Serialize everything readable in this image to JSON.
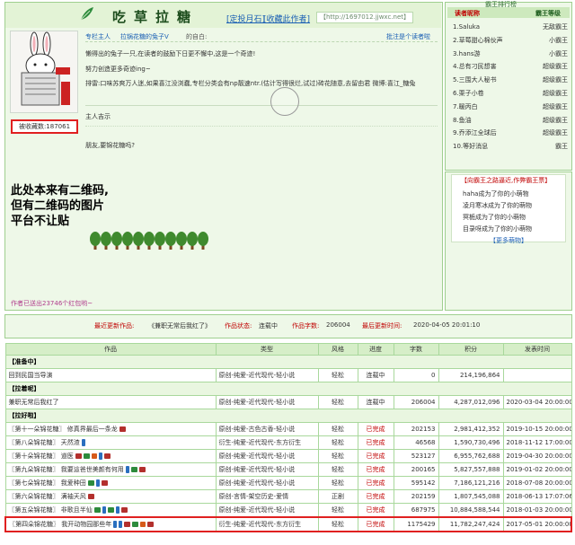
{
  "header": {
    "author_name": "吃草拉糖",
    "subscribe_link": "[定投月石]",
    "favorite_link": "[收藏此作者]",
    "url": "【http://1697012.jjwxc.net】"
  },
  "profile": {
    "role_label": "专栏主人",
    "title_label": "拉锅花糖的兔子V",
    "self_intro_label": "的自白:",
    "follow_link": "批注是个读者啦",
    "bio_line1": "懒得出的兔子一只,在读者的鼓励下日更不懈中,这是一个奇迹!",
    "bio_line2": "努力创造更多奇迹ing~",
    "bio_line3": "排雷:口味苏爽万人迷,如果喜江没浏蠢,专栏分类会有np靓速ntr.(估计写得很烂,试过)砖花随意,去留由君 微博:喜江_糖兔",
    "bio_line4": "主人吉示",
    "bio_line5": "朋友,要锦花糖吗?",
    "favorite_count": "被收藏数:187061",
    "qr_note_line1": "此处本来有二维码,",
    "qr_note_line2": "但有二维码的图片",
    "qr_note_line3": "平台不让贴",
    "sent_redbag": "作者已送出23746个红包哟~",
    "tree_count": 11
  },
  "fans": {
    "panel_title": "霸王排行榜",
    "col_reader": "读者昵称",
    "col_rank": "霸王等级",
    "rows": [
      {
        "name": "1.Saluka",
        "rank": "无敌霸王"
      },
      {
        "name": "2.草莓甜心棉伙声",
        "rank": "小霸王"
      },
      {
        "name": "3.hans游",
        "rank": "小霸王"
      },
      {
        "name": "4.总有刁民想害",
        "rank": "超级霸王"
      },
      {
        "name": "5.三围大人秘书",
        "rank": "超级霸王"
      },
      {
        "name": "6.栗子小卷",
        "rank": "超级霸王"
      },
      {
        "name": "7.暖丙白",
        "rank": "超级霸王"
      },
      {
        "name": "8.鱼油",
        "rank": "超级霸王"
      },
      {
        "name": "9.乔添江全球后",
        "rank": "超级霸王"
      },
      {
        "name": "10.等好消息",
        "rank": "霸王"
      }
    ],
    "box_title": "【向霸王之路逼近,作弊霸王票】",
    "news": [
      "haha成为了你的小萌物",
      "凌月寒冰成为了你的萌物",
      "冥栀成为了你的小萌物",
      "目录呀成为了你的小萌物"
    ],
    "more_pets": "【更多萌物】"
  },
  "latest_work": {
    "label": "最近更新作品:",
    "title": "《兼职无常后我红了》",
    "status_label": "作品状态:",
    "status": "连载中",
    "words_label": "作品字数:",
    "words": "206004",
    "time_label": "最后更新时间:",
    "time": "2020-04-05 20:01:10"
  },
  "works_table": {
    "headers": [
      "作品",
      "类型",
      "风格",
      "进度",
      "字数",
      "积分",
      "发表时间"
    ],
    "sections": [
      {
        "title": "【准备中】",
        "rows": [
          {
            "title": "回到民国当导演",
            "type": "原创-纯爱-近代现代-轻小说",
            "style": "轻松",
            "progress": "连载中",
            "words": "0",
            "score": "214,196,864",
            "date": "",
            "red": false,
            "tags": []
          }
        ]
      },
      {
        "title": "【拉着呢】",
        "rows": [
          {
            "title": "兼职无常后我红了",
            "type": "原创-纯爱-近代现代-轻小说",
            "style": "轻松",
            "progress": "连载中",
            "words": "206004",
            "score": "4,287,012,096",
            "date": "2020-03-04 20:00:00",
            "red": false,
            "tags": []
          }
        ]
      },
      {
        "title": "【拉好啦】",
        "rows": [
          {
            "title": "〖第十一朵锦花糖〗   修真界最后一条龙",
            "type": "原创-纯爱-古色古香-轻小说",
            "style": "轻松",
            "progress": "已完成",
            "words": "202153",
            "score": "2,981,412,352",
            "date": "2019-10-15 20:00:00",
            "red": true,
            "tags": [
              "book"
            ]
          },
          {
            "title": "〖第八朵锦花糖〗   天然渣",
            "type": "衍生-纯爱-近代现代-东方衍生",
            "style": "轻松",
            "progress": "已完成",
            "words": "46568",
            "score": "1,590,730,496",
            "date": "2018-11-12 17:00:00",
            "red": true,
            "tags": [
              "pen"
            ]
          },
          {
            "title": "〖第十朵锦花糖〗   道医",
            "type": "原创-纯爱-近代现代-轻小说",
            "style": "轻松",
            "progress": "已完成",
            "words": "523127",
            "score": "6,955,762,688",
            "date": "2019-04-30 20:00:00",
            "red": true,
            "tags": [
              "book",
              "green",
              "ladder",
              "pen",
              "book"
            ]
          },
          {
            "title": "〖第九朵锦花糖〗   我要這爸世美颜有何用",
            "type": "原创-纯爱-近代现代-轻小说",
            "style": "轻松",
            "progress": "已完成",
            "words": "200165",
            "score": "5,827,557,888",
            "date": "2019-01-02 20:00:00",
            "red": true,
            "tags": [
              "pen",
              "green",
              "book"
            ]
          },
          {
            "title": "〖第七朵锦花糖〗   我爱种田",
            "type": "原创-纯爱-近代现代-轻小说",
            "style": "轻松",
            "progress": "已完成",
            "words": "595142",
            "score": "7,186,121,216",
            "date": "2018-07-08 20:00:00",
            "red": true,
            "tags": [
              "green",
              "pen",
              "book"
            ]
          },
          {
            "title": "〖第六朵锦花糖〗   满袖天风",
            "type": "原创-言情-架空历史-爱情",
            "style": "正剧",
            "progress": "已完成",
            "words": "202159",
            "score": "1,807,545,088",
            "date": "2018-06-13 17:07:06",
            "red": true,
            "tags": [
              "book"
            ]
          },
          {
            "title": "〖第五朵锦花糖〗   非歌且半仙",
            "type": "原创-纯爱-近代现代-轻小说",
            "style": "轻松",
            "progress": "已完成",
            "words": "687975",
            "score": "10,884,588,544",
            "date": "2018-01-03 20:00:00",
            "red": true,
            "tags": [
              "green",
              "pen",
              "green",
              "pen",
              "book"
            ]
          },
          {
            "title": "〖第四朵锦花糖〗   我开动物园那些年",
            "type": "衍生-纯爱-近代现代-东方衍生",
            "style": "轻松",
            "progress": "已完成",
            "words": "1175429",
            "score": "11,782,247,424",
            "date": "2017-05-01 20:00:00",
            "red": true,
            "tags": [
              "pen",
              "pen",
              "book",
              "green",
              "ladder",
              "book"
            ],
            "highlight": true
          }
        ]
      }
    ]
  },
  "colors": {
    "panel_bg": "#eef8e8",
    "border_green": "#9fcf8f",
    "link_blue": "#1a5fb4",
    "accent_red": "#c00000",
    "highlight_red": "#e02020"
  }
}
